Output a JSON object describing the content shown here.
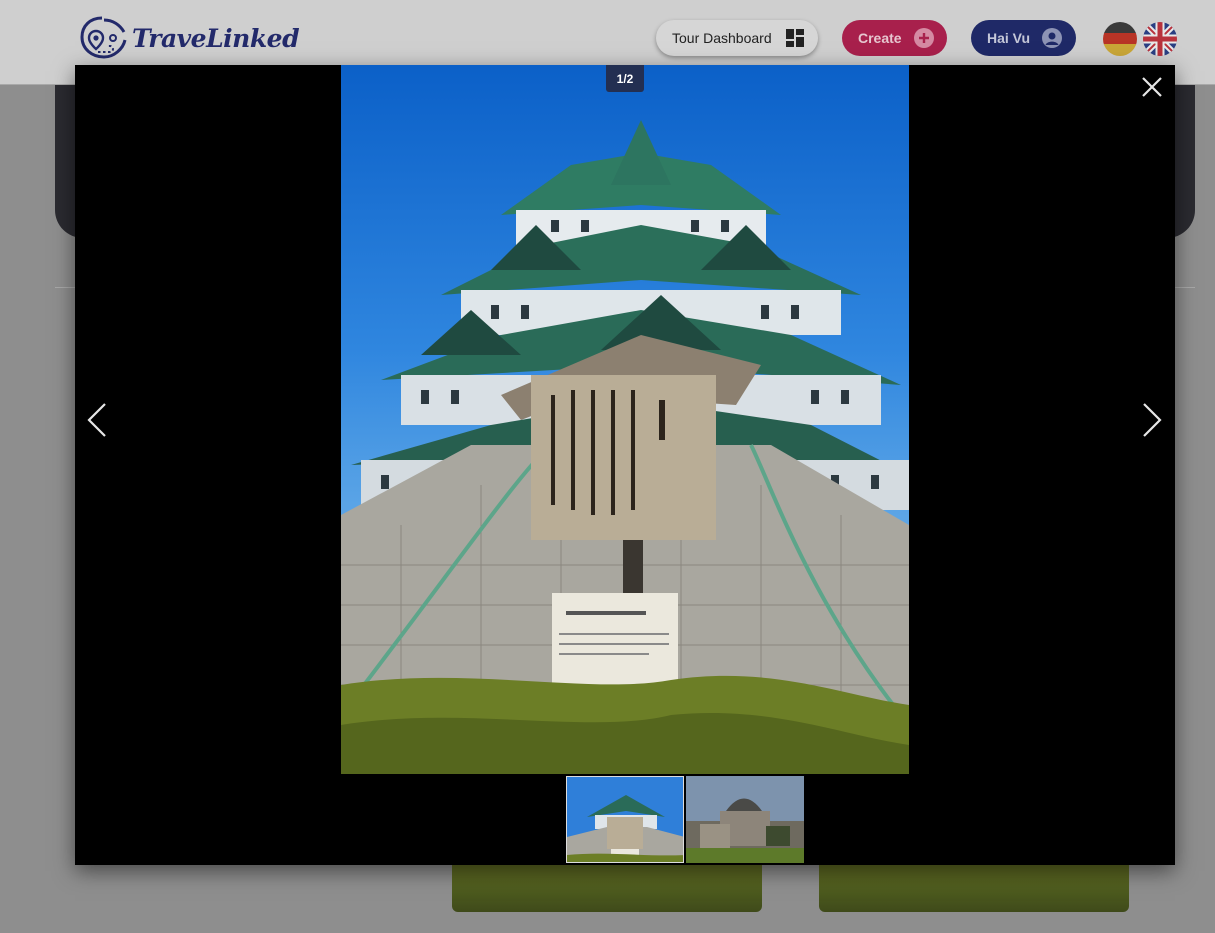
{
  "header": {
    "logo_text": "TraveLinked",
    "logo_icon": "map-pin-route-icon",
    "tour_dashboard_label": "Tour Dashboard",
    "tour_dashboard_icon": "dashboard-grid-icon",
    "create_label": "Create",
    "create_icon": "plus-circle-icon",
    "user_label": "Hai Vu",
    "user_icon": "user-circle-icon",
    "languages": [
      "German",
      "English"
    ]
  },
  "lightbox": {
    "counter": "1/2",
    "close_icon": "close-icon",
    "prev_icon": "chevron-left-icon",
    "next_icon": "chevron-right-icon",
    "current_image": "Nagoya Castle with wooden sign",
    "sign_english_title": "Wall of Swords",
    "sign_english_text": "The corridor connecting the Main Castle Tower and the Minor Castle Tower is mounted with a line of spikes to deter invaders.",
    "sign_japanese_title": "剣塀",
    "thumbnails": [
      "Nagoya Castle",
      "Hiroshima Peace Memorial Dome"
    ]
  },
  "colors": {
    "header_bg": "#cfcfcf",
    "logo": "#232a6b",
    "create_bg": "#a8204c",
    "user_bg": "#1f2967",
    "overlay_bg": "#000000",
    "counter_bg": "#232f52"
  }
}
